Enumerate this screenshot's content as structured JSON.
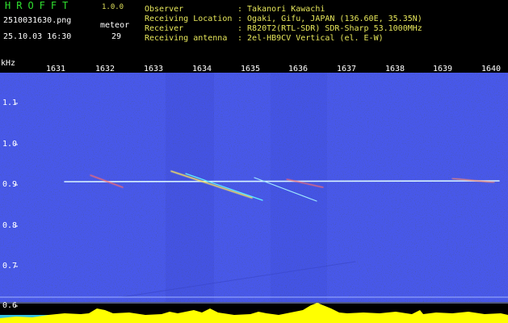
{
  "app": {
    "name": "HROFFT",
    "version": "1.0.0"
  },
  "file": {
    "name": "2510031630.png",
    "datetime": "25.10.03 16:30"
  },
  "meteor": {
    "label": "meteor",
    "count": "29"
  },
  "info": [
    {
      "label": "Observer",
      "value": ": Takanori Kawachi"
    },
    {
      "label": "Receiving Location",
      "value": ": Ogaki, Gifu, JAPAN (136.60E, 35.35N)"
    },
    {
      "label": "Receiver",
      "value": ": R820T2(RTL-SDR) SDR-Sharp 53.1000MHz"
    },
    {
      "label": "Receiving antenna",
      "value": ": 2el-HB9CV Vertical (el. E-W)"
    }
  ],
  "axis": {
    "unit": "kHz",
    "x_ticks": [
      "1631",
      "1632",
      "1633",
      "1634",
      "1635",
      "1636",
      "1637",
      "1638",
      "1639",
      "1640"
    ],
    "y_ticks": [
      "1.1",
      "1.0",
      "0.9",
      "0.8",
      "0.7",
      "0.6"
    ]
  },
  "colors": {
    "background": "#000000",
    "noise": "#1a1f8c",
    "trace": "#e0f4ff",
    "level_fill": "#ffff00",
    "level_base": "#35c3e0",
    "label": "#ffffff",
    "app_title": "#2fe02f",
    "info_text": "#e6e65a"
  }
}
